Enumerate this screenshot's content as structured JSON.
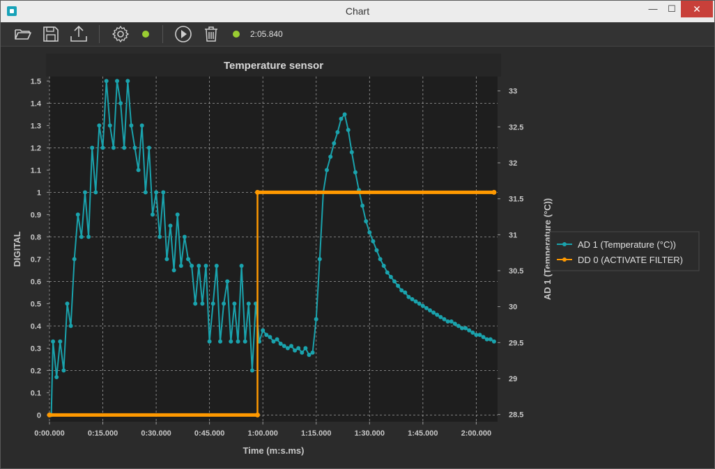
{
  "window": {
    "title": "Chart",
    "minimize_symbol": "—",
    "maximize_symbol": "☐",
    "close_symbol": "✕"
  },
  "toolbar": {
    "icons": [
      "folder-open-icon",
      "save-icon",
      "export-icon",
      "gear-icon",
      "status-dot",
      "play-icon",
      "trash-icon",
      "status-dot"
    ],
    "status_color": "#9acd32",
    "elapsed": "2:05.840"
  },
  "colors": {
    "series_ad1": "#1aa3ad",
    "series_dd0": "#ff9900",
    "plot_bg": "#1e1e1e",
    "panel_bg": "#2b2b2b"
  },
  "chart_data": {
    "type": "line",
    "title": "Temperature sensor",
    "xlabel": "Time (m:s.ms)",
    "ylabel_left": "DIGITAL",
    "ylabel_right": "AD 1 (Temperature (°C))",
    "x_unit": "seconds",
    "xlim": [
      0,
      126
    ],
    "ylim_left": [
      -0.03,
      1.52
    ],
    "ylim_right": [
      28.4,
      33.2
    ],
    "x_ticks": [
      0,
      15,
      30,
      45,
      60,
      75,
      90,
      105,
      120
    ],
    "x_tick_labels": [
      "0:00.000",
      "0:15.000",
      "0:30.000",
      "0:45.000",
      "1:00.000",
      "1:15.000",
      "1:30.000",
      "1:45.000",
      "2:00.000"
    ],
    "y_left_ticks": [
      0,
      0.1,
      0.2,
      0.3,
      0.4,
      0.5,
      0.6,
      0.7,
      0.8,
      0.9,
      1,
      1.1,
      1.2,
      1.3,
      1.4,
      1.5
    ],
    "y_left_tick_labels": [
      "0",
      "0.1",
      "0.2",
      "0.3",
      "0.4",
      "0.5",
      "0.6",
      "0.7",
      "0.8",
      "0.9",
      "1",
      "1.1",
      "1.2",
      "1.3",
      "1.4",
      "1.5"
    ],
    "y_right_ticks": [
      28.5,
      29,
      29.5,
      30,
      30.5,
      31,
      31.5,
      32,
      32.5,
      33
    ],
    "y_right_tick_labels": [
      "28.5",
      "29",
      "29.5",
      "30",
      "30.5",
      "31",
      "31.5",
      "32",
      "32.5",
      "33"
    ],
    "grid": true,
    "legend_position": "right",
    "series": [
      {
        "name": "AD 1 (Temperature (°C))",
        "axis": "left",
        "color": "#1aa3ad",
        "x": [
          0.5,
          1,
          2,
          3,
          4,
          5,
          6,
          7,
          8,
          9,
          10,
          11,
          12,
          13,
          14,
          15,
          16,
          17,
          18,
          19,
          20,
          21,
          22,
          23,
          24,
          25,
          26,
          27,
          28,
          29,
          30,
          31,
          32,
          33,
          34,
          35,
          36,
          37,
          38,
          39,
          40,
          41,
          42,
          43,
          44,
          45,
          46,
          47,
          48,
          49,
          50,
          51,
          52,
          53,
          54,
          55,
          56,
          57,
          58,
          59,
          60,
          61,
          62,
          63,
          64,
          65,
          66,
          67,
          68,
          69,
          70,
          71,
          72,
          73,
          74,
          75,
          76,
          77,
          78,
          79,
          80,
          81,
          82,
          83,
          84,
          85,
          86,
          87,
          88,
          89,
          90,
          91,
          92,
          93,
          94,
          95,
          96,
          97,
          98,
          99,
          100,
          101,
          102,
          103,
          104,
          105,
          106,
          107,
          108,
          109,
          110,
          111,
          112,
          113,
          114,
          115,
          116,
          117,
          118,
          119,
          120,
          121,
          122,
          123,
          124,
          125
        ],
        "y": [
          0,
          0.33,
          0.17,
          0.33,
          0.2,
          0.5,
          0.4,
          0.7,
          0.9,
          0.8,
          1.0,
          0.8,
          1.2,
          1.0,
          1.3,
          1.2,
          1.5,
          1.3,
          1.2,
          1.5,
          1.4,
          1.2,
          1.5,
          1.3,
          1.2,
          1.1,
          1.3,
          1.0,
          1.2,
          0.9,
          1.0,
          0.8,
          1.0,
          0.7,
          0.85,
          0.65,
          0.9,
          0.67,
          0.8,
          0.7,
          0.67,
          0.5,
          0.67,
          0.5,
          0.67,
          0.33,
          0.5,
          0.67,
          0.33,
          0.5,
          0.6,
          0.33,
          0.5,
          0.33,
          0.67,
          0.33,
          0.5,
          0.2,
          0.5,
          0.33,
          0.38,
          0.36,
          0.35,
          0.33,
          0.34,
          0.32,
          0.31,
          0.3,
          0.31,
          0.29,
          0.3,
          0.28,
          0.3,
          0.27,
          0.28,
          0.43,
          0.7,
          1.0,
          1.1,
          1.16,
          1.22,
          1.27,
          1.33,
          1.35,
          1.28,
          1.18,
          1.09,
          1.01,
          0.94,
          0.87,
          0.82,
          0.78,
          0.74,
          0.7,
          0.67,
          0.64,
          0.62,
          0.6,
          0.58,
          0.56,
          0.55,
          0.53,
          0.52,
          0.51,
          0.5,
          0.49,
          0.48,
          0.47,
          0.46,
          0.45,
          0.44,
          0.43,
          0.42,
          0.42,
          0.41,
          0.4,
          0.39,
          0.39,
          0.38,
          0.37,
          0.36,
          0.36,
          0.35,
          0.34,
          0.34,
          0.33
        ]
      },
      {
        "name": "DD 0 (ACTIVATE FILTER)",
        "axis": "left",
        "color": "#ff9900",
        "x": [
          0,
          58.5,
          58.5,
          125
        ],
        "y": [
          0,
          0,
          1,
          1
        ]
      }
    ]
  }
}
